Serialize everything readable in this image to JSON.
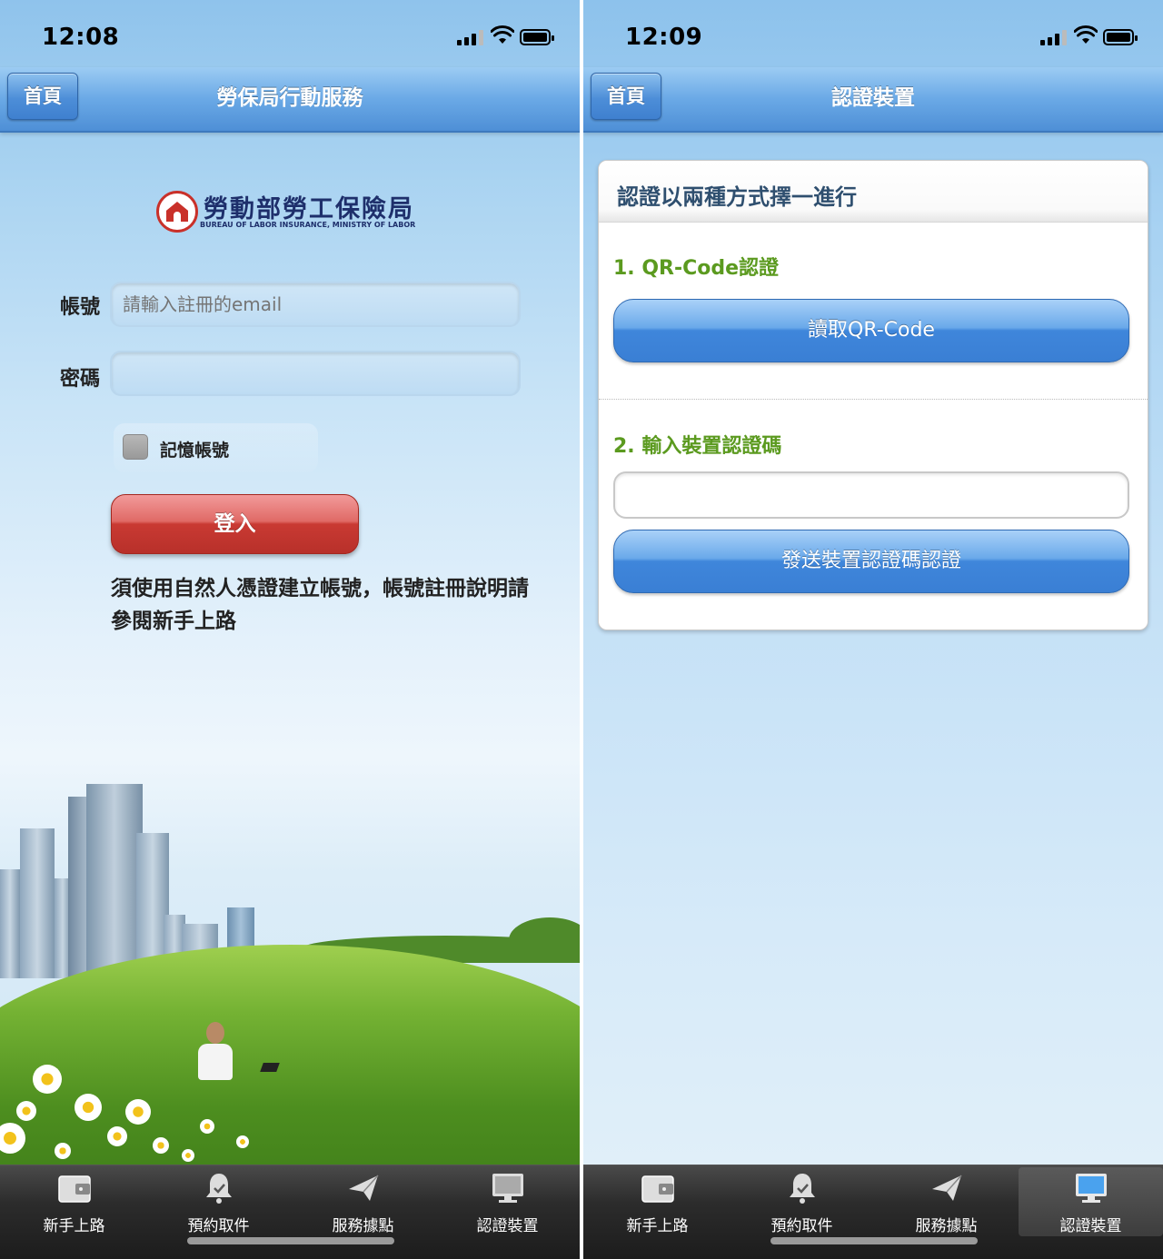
{
  "left": {
    "status": {
      "time": "12:08"
    },
    "nav": {
      "home_label": "首頁",
      "title": "勞保局行動服務"
    },
    "logo": {
      "cn": "勞動部勞工保險局",
      "en": "BUREAU OF LABOR INSURANCE, MINISTRY OF LABOR"
    },
    "form": {
      "account_label": "帳號",
      "account_placeholder": "請輸入註冊的email",
      "password_label": "密碼",
      "remember_label": "記憶帳號",
      "login_label": "登入"
    },
    "note": "須使用自然人憑證建立帳號，帳號註冊說明請參閱新手上路"
  },
  "right": {
    "status": {
      "time": "12:09"
    },
    "nav": {
      "home_label": "首頁",
      "title": "認證裝置"
    },
    "card": {
      "title": "認證以兩種方式擇一進行",
      "section1_title": "1. QR-Code認證",
      "read_qr_button": "讀取QR-Code",
      "section2_title": "2. 輸入裝置認證碼",
      "send_code_button": "發送裝置認證碼認證"
    }
  },
  "tabbar": {
    "items": [
      {
        "label": "新手上路",
        "icon": "wallet-icon"
      },
      {
        "label": "預約取件",
        "icon": "bell-icon"
      },
      {
        "label": "服務據點",
        "icon": "paper-plane-icon"
      },
      {
        "label": "認證裝置",
        "icon": "monitor-icon"
      }
    ],
    "right_active_index": 3
  },
  "colors": {
    "nav_blue": "#4e8fd6",
    "login_red": "#c93a33",
    "section_green": "#5b9a1f",
    "button_blue": "#3f86db"
  }
}
